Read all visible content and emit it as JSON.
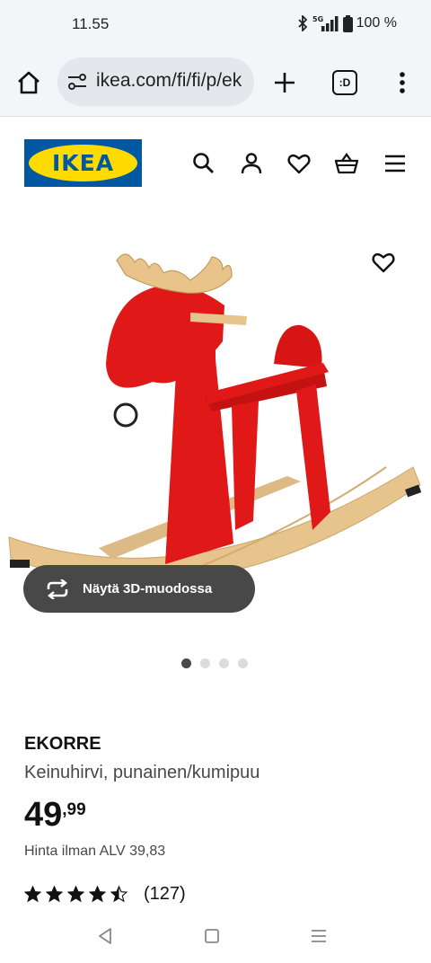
{
  "status_bar": {
    "time": "11.55",
    "network": "5G",
    "battery": "100 %",
    "icons": [
      "bluetooth-icon",
      "signal-icon",
      "battery-icon"
    ]
  },
  "browser": {
    "url": "ikea.com/fi/fi/p/ek",
    "tabs_label": ":D",
    "icons": [
      "home-icon",
      "site-settings-icon",
      "new-tab-icon",
      "tab-switcher-icon",
      "more-menu-icon"
    ]
  },
  "header": {
    "logo_text": "IKEA",
    "icons": [
      "search-icon",
      "account-icon",
      "wishlist-icon",
      "cart-icon",
      "hamburger-icon"
    ]
  },
  "gallery": {
    "view_3d_label": "Näytä 3D-muodossa",
    "image_count": 4,
    "active_index": 0
  },
  "product": {
    "name": "EKORRE",
    "description": "Keinuhirvi, punainen/kumipuu",
    "price_integer": "49",
    "price_decimal": ",99",
    "price_excl_vat": "Hinta ilman ALV 39,83",
    "rating": 4.5,
    "rating_max": 5,
    "review_count": "(127)"
  },
  "colors": {
    "ikea_blue": "#0058a3",
    "ikea_yellow": "#ffdb00",
    "moose_red": "#e01818",
    "wood": "#e6c48c",
    "button_dark": "#484848"
  }
}
